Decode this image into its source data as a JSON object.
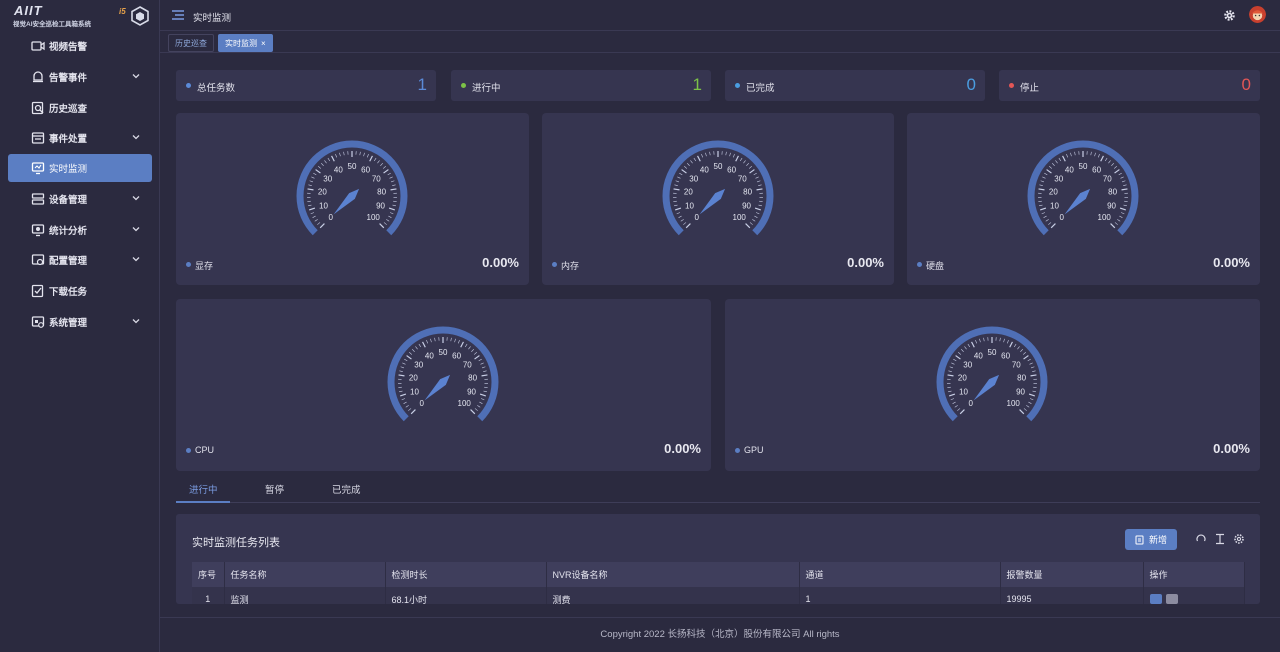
{
  "logo": {
    "brand": "AIIT",
    "subtitle": "视觉AI安全巡检工具箱系统",
    "badge": "i5"
  },
  "sidebar": {
    "items": [
      {
        "label": "视频告警",
        "icon": "video-alarm-icon",
        "expandable": false,
        "active": false
      },
      {
        "label": "告警事件",
        "icon": "alarm-event-icon",
        "expandable": true,
        "active": false
      },
      {
        "label": "历史巡查",
        "icon": "history-search-icon",
        "expandable": false,
        "active": false
      },
      {
        "label": "事件处置",
        "icon": "event-handle-icon",
        "expandable": true,
        "active": false
      },
      {
        "label": "实时监测",
        "icon": "monitor-icon",
        "expandable": false,
        "active": true
      },
      {
        "label": "设备管理",
        "icon": "device-icon",
        "expandable": true,
        "active": false
      },
      {
        "label": "统计分析",
        "icon": "statistics-icon",
        "expandable": true,
        "active": false
      },
      {
        "label": "配置管理",
        "icon": "config-icon",
        "expandable": true,
        "active": false
      },
      {
        "label": "下载任务",
        "icon": "download-icon",
        "expandable": false,
        "active": false
      },
      {
        "label": "系统管理",
        "icon": "system-icon",
        "expandable": true,
        "active": false
      }
    ]
  },
  "header": {
    "title": "实时监测"
  },
  "tabs": [
    {
      "label": "历史巡查",
      "active": false
    },
    {
      "label": "实时监测",
      "active": true,
      "close": "×"
    }
  ],
  "stats": [
    {
      "label": "总任务数",
      "value": "1",
      "color": "#5b8ad8"
    },
    {
      "label": "进行中",
      "value": "1",
      "color": "#7cc247"
    },
    {
      "label": "已完成",
      "value": "0",
      "color": "#4a9de0"
    },
    {
      "label": "停止",
      "value": "0",
      "color": "#e35656"
    }
  ],
  "gauges": [
    {
      "label": "显存",
      "value": "0.00%",
      "percent": 0
    },
    {
      "label": "内存",
      "value": "0.00%",
      "percent": 0
    },
    {
      "label": "硬盘",
      "value": "0.00%",
      "percent": 0
    },
    {
      "label": "CPU",
      "value": "0.00%",
      "percent": 0
    },
    {
      "label": "GPU",
      "value": "0.00%",
      "percent": 0
    }
  ],
  "gauge_ticks": [
    "0",
    "10",
    "20",
    "30",
    "40",
    "50",
    "60",
    "70",
    "80",
    "90",
    "100"
  ],
  "task_tabs": [
    {
      "label": "进行中",
      "active": true
    },
    {
      "label": "暂停",
      "active": false
    },
    {
      "label": "已完成",
      "active": false
    }
  ],
  "panel": {
    "title": "实时监测任务列表",
    "add_label": "新增",
    "columns": [
      "序号",
      "任务名称",
      "检测时长",
      "NVR设备名称",
      "通道",
      "报警数量",
      "操作"
    ],
    "rows": [
      [
        "1",
        "监测",
        "68.1小时",
        "测费",
        "1",
        "19995",
        ""
      ]
    ]
  },
  "footer": {
    "text": "Copyright 2022 长扬科技（北京）股份有限公司 All rights"
  },
  "colors": {
    "accent": "#5b7ec3",
    "background": "#2b2a3f",
    "card": "#363550"
  }
}
